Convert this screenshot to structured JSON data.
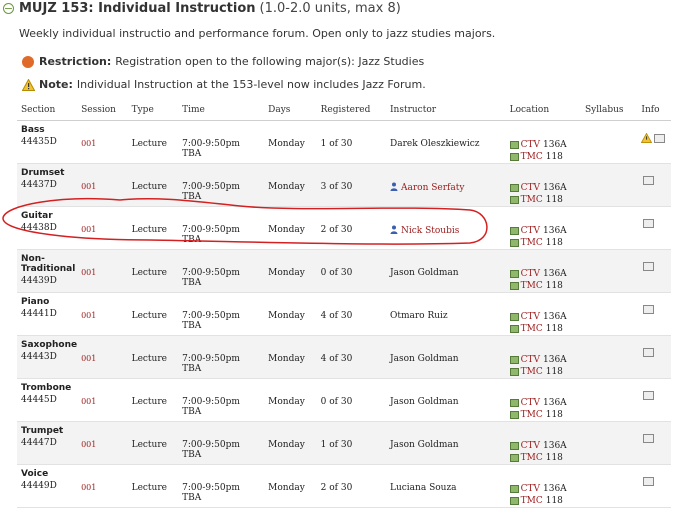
{
  "course": {
    "code_title": "MUJZ 153: Individual Instruction",
    "units": "(1.0-2.0 units, max 8)",
    "description": "Weekly individual instructio and performance forum. Open only to jazz studies majors.",
    "restriction_label": "Restriction:",
    "restriction_text": "Registration open to the following major(s): Jazz Studies",
    "note_label": "Note:",
    "note_text": "Individual Instruction at the 153-level now includes Jazz Forum."
  },
  "table": {
    "headers": [
      "Section",
      "Session",
      "Type",
      "Time",
      "Days",
      "Registered",
      "Instructor",
      "Location",
      "Syllabus",
      "Info"
    ],
    "rows": [
      {
        "name": "Bass",
        "section": "44435D",
        "session": "001",
        "type": "Lecture",
        "time": "7:00-9:50pm",
        "time2": "TBA",
        "days": "Monday",
        "registered": "1 of 30",
        "instructor": "Darek Oleszkiewicz",
        "instructor_link": false,
        "loc1_bldg": "CTV",
        "loc1_room": "136A",
        "loc2_bldg": "TMC",
        "loc2_room": "118",
        "warn": true
      },
      {
        "name": "Drumset",
        "section": "44437D",
        "session": "001",
        "type": "Lecture",
        "time": "7:00-9:50pm",
        "time2": "TBA",
        "days": "Monday",
        "registered": "3 of 30",
        "instructor": "Aaron Serfaty",
        "instructor_link": true,
        "loc1_bldg": "CTV",
        "loc1_room": "136A",
        "loc2_bldg": "TMC",
        "loc2_room": "118",
        "warn": false
      },
      {
        "name": "Guitar",
        "section": "44438D",
        "session": "001",
        "type": "Lecture",
        "time": "7:00-9:50pm",
        "time2": "TBA",
        "days": "Monday",
        "registered": "2 of 30",
        "instructor": "Nick Stoubis",
        "instructor_link": true,
        "loc1_bldg": "CTV",
        "loc1_room": "136A",
        "loc2_bldg": "TMC",
        "loc2_room": "118",
        "warn": false
      },
      {
        "name": "Non-Traditional",
        "section": "44439D",
        "session": "001",
        "type": "Lecture",
        "time": "7:00-9:50pm",
        "time2": "TBA",
        "days": "Monday",
        "registered": "0 of 30",
        "instructor": "Jason Goldman",
        "instructor_link": false,
        "loc1_bldg": "CTV",
        "loc1_room": "136A",
        "loc2_bldg": "TMC",
        "loc2_room": "118",
        "warn": false
      },
      {
        "name": "Piano",
        "section": "44441D",
        "session": "001",
        "type": "Lecture",
        "time": "7:00-9:50pm",
        "time2": "TBA",
        "days": "Monday",
        "registered": "4 of 30",
        "instructor": "Otmaro Ruiz",
        "instructor_link": false,
        "loc1_bldg": "CTV",
        "loc1_room": "136A",
        "loc2_bldg": "TMC",
        "loc2_room": "118",
        "warn": false
      },
      {
        "name": "Saxophone",
        "section": "44443D",
        "session": "001",
        "type": "Lecture",
        "time": "7:00-9:50pm",
        "time2": "TBA",
        "days": "Monday",
        "registered": "4 of 30",
        "instructor": "Jason Goldman",
        "instructor_link": false,
        "loc1_bldg": "CTV",
        "loc1_room": "136A",
        "loc2_bldg": "TMC",
        "loc2_room": "118",
        "warn": false
      },
      {
        "name": "Trombone",
        "section": "44445D",
        "session": "001",
        "type": "Lecture",
        "time": "7:00-9:50pm",
        "time2": "TBA",
        "days": "Monday",
        "registered": "0 of 30",
        "instructor": "Jason Goldman",
        "instructor_link": false,
        "loc1_bldg": "CTV",
        "loc1_room": "136A",
        "loc2_bldg": "TMC",
        "loc2_room": "118",
        "warn": false
      },
      {
        "name": "Trumpet",
        "section": "44447D",
        "session": "001",
        "type": "Lecture",
        "time": "7:00-9:50pm",
        "time2": "TBA",
        "days": "Monday",
        "registered": "1 of 30",
        "instructor": "Jason Goldman",
        "instructor_link": false,
        "loc1_bldg": "CTV",
        "loc1_room": "136A",
        "loc2_bldg": "TMC",
        "loc2_room": "118",
        "warn": false
      },
      {
        "name": "Voice",
        "section": "44449D",
        "session": "001",
        "type": "Lecture",
        "time": "7:00-9:50pm",
        "time2": "TBA",
        "days": "Monday",
        "registered": "2 of 30",
        "instructor": "Luciana Souza",
        "instructor_link": false,
        "loc1_bldg": "CTV",
        "loc1_room": "136A",
        "loc2_bldg": "TMC",
        "loc2_room": "118",
        "warn": false
      }
    ]
  },
  "colors": {
    "link": "#9b1b1b",
    "annotation": "#d42020",
    "restriction": "#e06a2a",
    "row_alt": "#f3f3f3"
  },
  "icons": {
    "collapse": "minus-circle-icon",
    "restriction": "restriction-icon",
    "note": "warning-icon",
    "instructor": "person-icon",
    "location": "building-icon",
    "info": "info-icon"
  }
}
